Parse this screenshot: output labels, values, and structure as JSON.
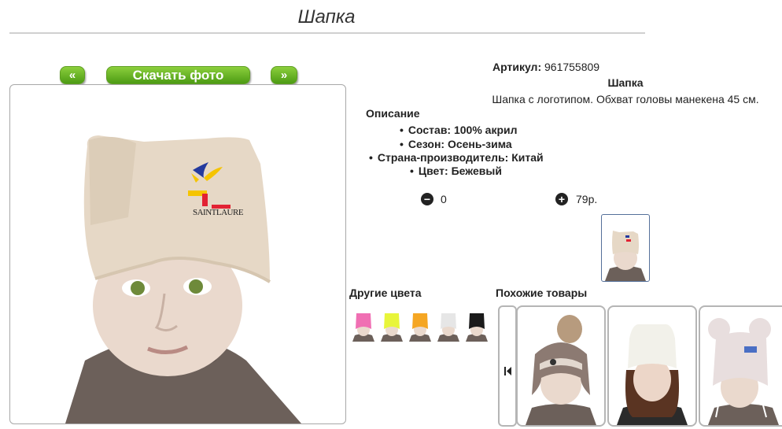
{
  "page": {
    "title": "Шапка"
  },
  "nav": {
    "prev_label": "«",
    "download_label": "Скачать фото",
    "next_label": "»"
  },
  "product": {
    "article_label": "Артикул:",
    "article_value": "961755809",
    "name": "Шапка",
    "description": "Шапка с логотипом. Обхват головы манекена 45 см.",
    "logo_text": "SAINTLAURE"
  },
  "details": {
    "heading": "Описание",
    "items": [
      "Состав: 100% акрил",
      "Сезон: Осень-зима",
      "Страна-производитель: Китай",
      "Цвет: Бежевый"
    ]
  },
  "quantity": {
    "minus_icon": "minus-circle-icon",
    "value": "0",
    "plus_icon": "plus-circle-icon",
    "price": "79р."
  },
  "other_colors": {
    "heading": "Другие цвета",
    "swatches": [
      "#f06fb3",
      "#e8f53a",
      "#f5a623",
      "#e6e6e6",
      "#1a1a1a"
    ]
  },
  "similar": {
    "heading": "Похожие товары",
    "arrow_icon": "first-page-icon"
  },
  "colors": {
    "button_green": "#5aac1c",
    "hat_beige": "#e6d8c6",
    "sweater": "#6a5e58"
  }
}
